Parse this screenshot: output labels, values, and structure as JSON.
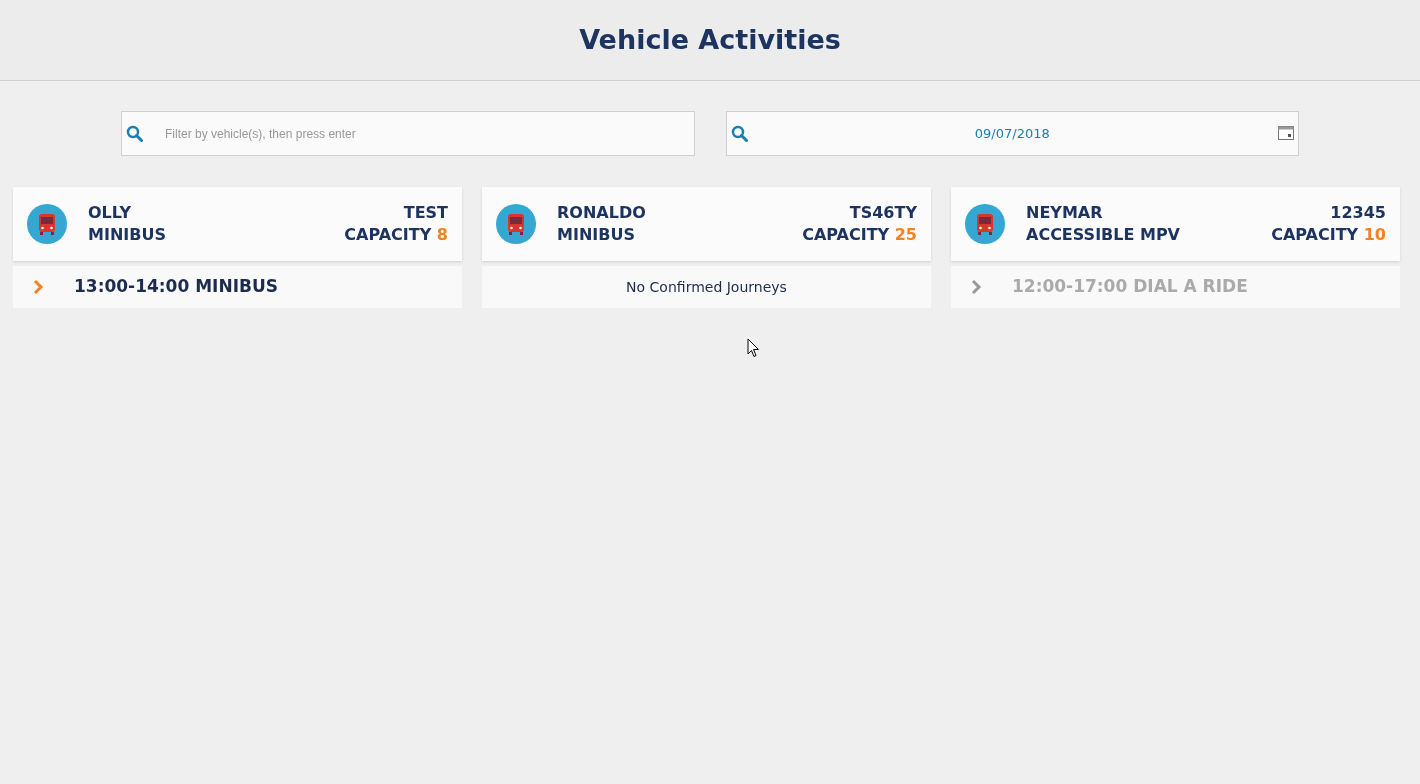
{
  "page": {
    "title": "Vehicle Activities"
  },
  "filters": {
    "vehicle_search": {
      "placeholder": "Filter by vehicle(s), then press enter"
    },
    "date": {
      "value": "09/07/2018"
    }
  },
  "vehicles": [
    {
      "name": "OLLY",
      "type": "MINIBUS",
      "registration": "TEST",
      "capacity_label": "CAPACITY",
      "capacity": "8",
      "journeys": [
        {
          "kind": "journey",
          "label": "13:00-14:00 MINIBUS",
          "disabled": false
        }
      ]
    },
    {
      "name": "RONALDO",
      "type": "MINIBUS",
      "registration": "TS46TY",
      "capacity_label": "CAPACITY",
      "capacity": "25",
      "journeys": [
        {
          "kind": "message",
          "label": "No Confirmed Journeys"
        }
      ]
    },
    {
      "name": "NEYMAR",
      "type": "ACCESSIBLE MPV",
      "registration": "12345",
      "capacity_label": "CAPACITY",
      "capacity": "10",
      "journeys": [
        {
          "kind": "journey",
          "label": "12:00-17:00 DIAL A RIDE",
          "disabled": true
        }
      ]
    }
  ]
}
